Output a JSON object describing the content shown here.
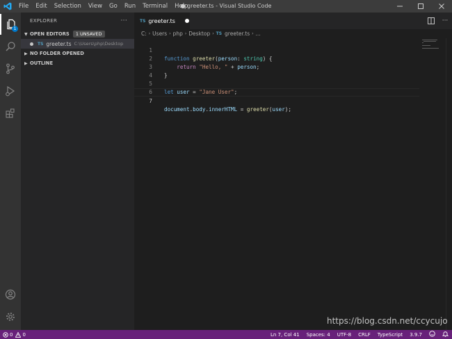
{
  "window": {
    "title": "● greeter.ts - Visual Studio Code",
    "menu": [
      "File",
      "Edit",
      "Selection",
      "View",
      "Go",
      "Run",
      "Terminal",
      "Help"
    ]
  },
  "activity": {
    "explorer_badge": "1"
  },
  "sidebar": {
    "header": "EXPLORER",
    "more": "···",
    "open_editors": {
      "label": "OPEN EDITORS",
      "badge": "1 UNSAVED"
    },
    "open_file": {
      "icon_label": "TS",
      "name": "greeter.ts",
      "path": "C:\\Users\\php\\Desktop"
    },
    "no_folder": "NO FOLDER OPENED",
    "outline": "OUTLINE"
  },
  "tab": {
    "icon_label": "TS",
    "name": "greeter.ts"
  },
  "breadcrumb": {
    "parts": [
      "C:",
      "Users",
      "php",
      "Desktop"
    ],
    "file_icon": "TS",
    "file": "greeter.ts",
    "ellipsis": "..."
  },
  "code": {
    "line_numbers": [
      "1",
      "2",
      "3",
      "4",
      "5",
      "6",
      "7"
    ],
    "l1": {
      "kw": "function",
      "sp": " ",
      "fn": "greeter",
      "p1": "(",
      "param": "person",
      "colon": ": ",
      "type": "string",
      "p2": ") {"
    },
    "l2": {
      "indent": "    ",
      "kw": "return",
      "sp": " ",
      "str": "\"Hello, \"",
      "op": " + ",
      "var": "person",
      "end": ";"
    },
    "l3": {
      "brace": "}"
    },
    "l5": {
      "kw": "let",
      "sp": " ",
      "var": "user",
      "eq": " = ",
      "str": "\"Jane User\"",
      "end": ";"
    },
    "l7": {
      "v1": "document",
      "d1": ".",
      "v2": "body",
      "d2": ".",
      "v3": "innerHTML",
      "eq": " = ",
      "fn": "greeter",
      "p1": "(",
      "arg": "user",
      "p2": ");"
    }
  },
  "status": {
    "errors": "0",
    "warnings": "0",
    "position": "Ln 7, Col 41",
    "spaces": "Spaces: 4",
    "encoding": "UTF-8",
    "eol": "CRLF",
    "language": "TypeScript",
    "version": "3.9.7"
  },
  "watermark": "https://blog.csdn.net/ccycujo",
  "colors": {
    "status_bar": "#68217a",
    "accent": "#007acc",
    "activity_bar": "#333333",
    "sidebar": "#252526",
    "editor": "#1e1e1e"
  }
}
